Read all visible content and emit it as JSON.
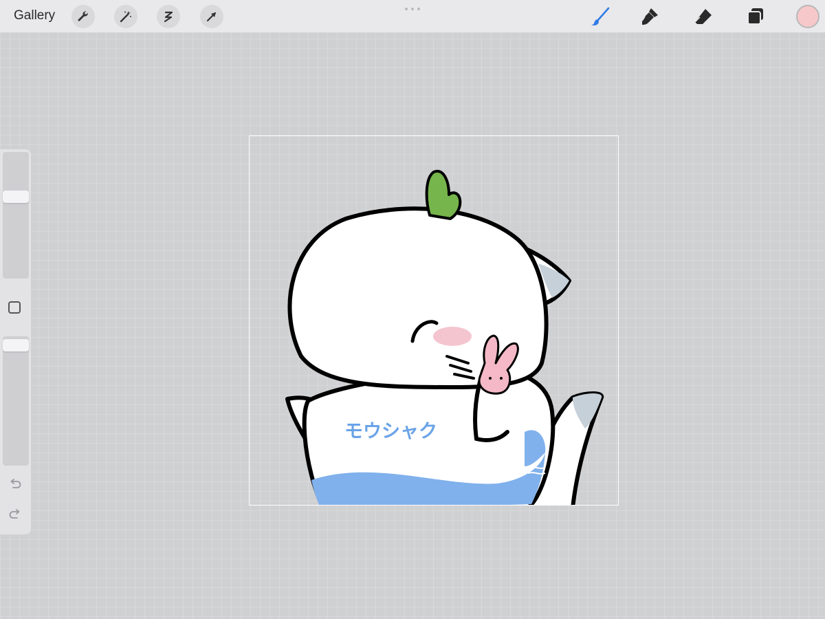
{
  "toolbar": {
    "gallery_label": "Gallery",
    "left_tools": [
      {
        "icon": "wrench-icon",
        "name": "actions"
      },
      {
        "icon": "magic-wand-icon",
        "name": "adjustments"
      },
      {
        "icon": "selection-icon",
        "name": "selection"
      },
      {
        "icon": "arrow-cursor-icon",
        "name": "transform"
      }
    ],
    "right_tools": [
      {
        "icon": "brush-icon",
        "name": "brush",
        "active": true
      },
      {
        "icon": "smudge-icon",
        "name": "smudge"
      },
      {
        "icon": "eraser-icon",
        "name": "eraser"
      },
      {
        "icon": "layers-icon",
        "name": "layers"
      }
    ],
    "current_color": "#f7c8c9"
  },
  "sidebar": {
    "brush_size_level": 0.85,
    "opacity_level": 0.9,
    "modify_button": "square",
    "undo_icon": "undo-icon",
    "redo_icon": "redo-icon"
  },
  "colors": {
    "accent": "#2f7be5",
    "canvas_bg": "#cfd0d2",
    "shirt_blue": "#80b1ec",
    "cactus_green": "#76b54b",
    "blush_pink": "#f5c5cf",
    "fin_grey": "#c6d0d8"
  },
  "canvas": {
    "shirt_text": "モウシャク"
  }
}
